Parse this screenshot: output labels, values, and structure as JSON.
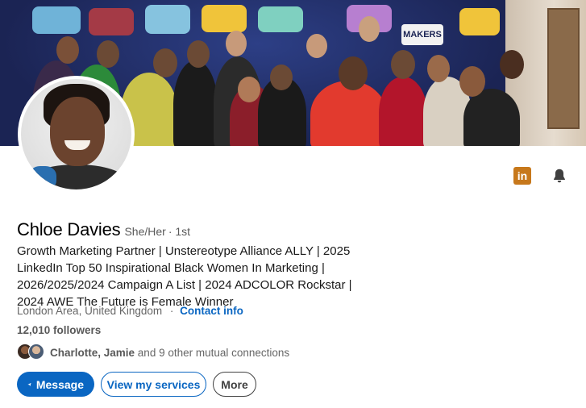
{
  "banner": {
    "sign_text": "MAKERS"
  },
  "profile": {
    "name": "Chloe Davies",
    "pronouns": "She/Her",
    "degree": "· 1st",
    "headline_lines": [
      "Growth Marketing Partner | Unstereotype Alliance ALLY | 2025",
      "LinkedIn Top 50 Inspirational Black Women In Marketing |",
      "2026/2025/2024 Campaign A List | 2024 ADCOLOR Rockstar |",
      "2024 AWE The Future is Female Winner"
    ],
    "location": "London Area, United Kingdom",
    "location_separator": "·",
    "contact_info_label": "Contact info",
    "followers": "12,010 followers",
    "mutual": {
      "names": "Charlotte, Jamie",
      "rest": " and 9 other mutual connections"
    }
  },
  "actions": {
    "message_label": "Message",
    "services_label": "View my services",
    "more_label": "More"
  },
  "icons": {
    "linkedin_glyph": "in"
  },
  "colors": {
    "accent": "#0a66c2",
    "linkedin_badge": "#c7781b"
  }
}
